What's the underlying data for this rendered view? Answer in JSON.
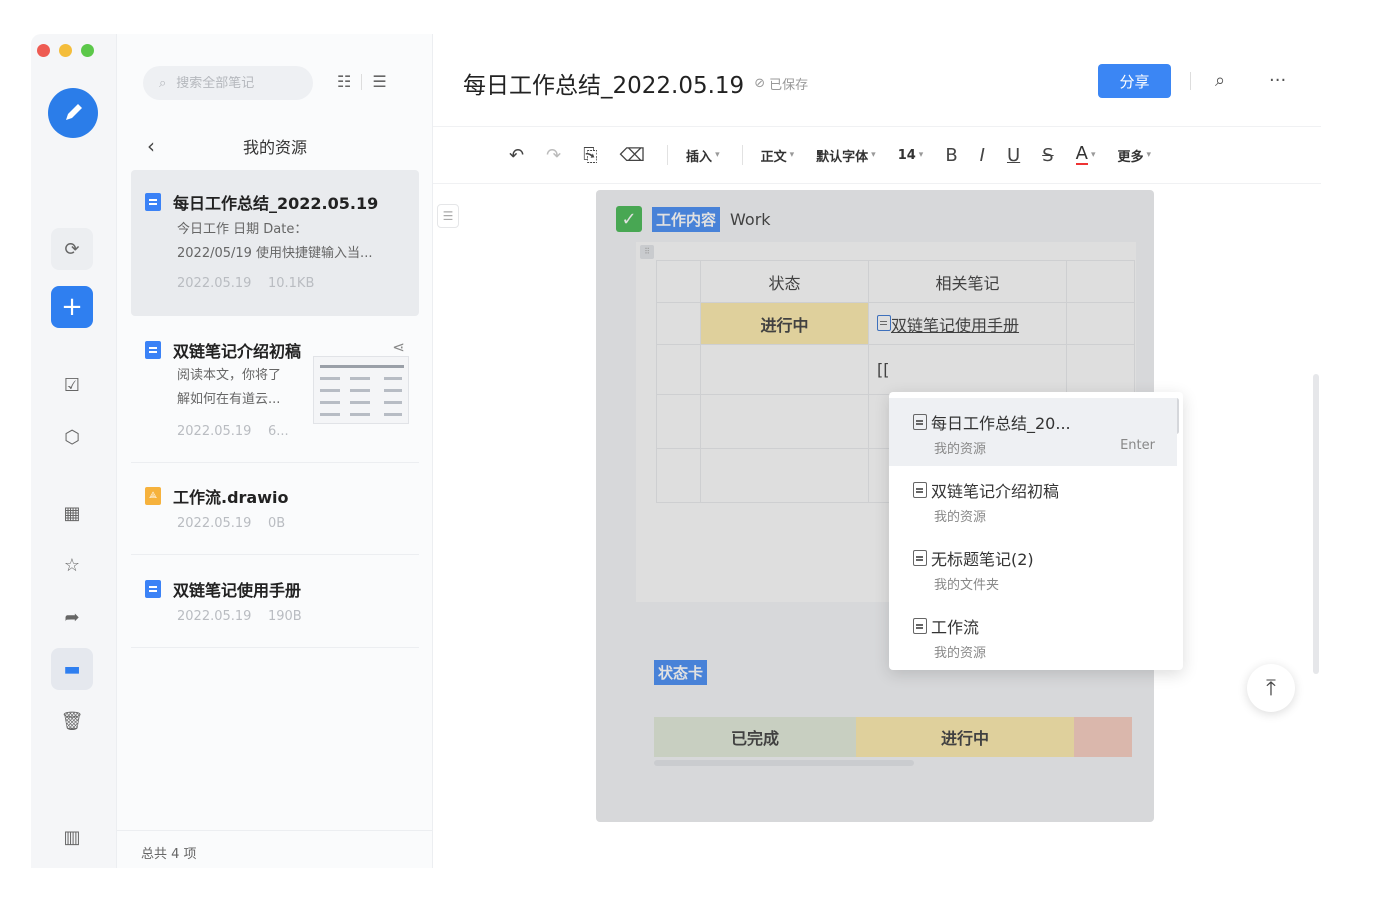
{
  "window": {
    "traffic_colors": [
      "#ee5b52",
      "#f4bd3b",
      "#5cc84a"
    ]
  },
  "rail": {
    "icons": [
      "sync-icon",
      "add-icon",
      "task-icon",
      "tag-icon",
      "apps-icon",
      "star-icon",
      "share-icon",
      "folder-icon",
      "trash-icon",
      "layout-icon"
    ],
    "add_label": "+"
  },
  "list": {
    "search_placeholder": "搜索全部笔记",
    "header_title": "我的资源",
    "footer": "总共 4 项",
    "notes": [
      {
        "title": "每日工作总结_2022.05.19",
        "summary_line1": "今日工作 日期 Date：",
        "summary_line2": "2022/05/19 使用快捷键输入当...",
        "date": "2022.05.19",
        "size": "10.1KB"
      },
      {
        "title": "双链笔记介绍初稿",
        "summary_line1": "阅读本文，你将了",
        "summary_line2": "解如何在有道云...",
        "date": "2022.05.19",
        "size": "6..."
      },
      {
        "title": "工作流.drawio",
        "date": "2022.05.19",
        "size": "0B"
      },
      {
        "title": "双链笔记使用手册",
        "date": "2022.05.19",
        "size": "190B"
      }
    ]
  },
  "editor": {
    "title": "每日工作总结_2022.05.19",
    "saved_label": "已保存",
    "share_label": "分享",
    "toolbar": {
      "insert": "插入",
      "paragraph": "正文",
      "font": "默认字体",
      "size": "14",
      "bold": "B",
      "italic": "I",
      "underline": "U",
      "strike": "S",
      "color": "A",
      "more": "更多"
    },
    "section": {
      "tag": "工作内容",
      "word": "Work"
    },
    "table": {
      "headers": [
        "状态",
        "相关笔记"
      ],
      "row1": [
        "进行中",
        "双链笔记使用手册"
      ],
      "typing": "[["
    },
    "status_card": {
      "tag": "状态卡",
      "done": "已完成",
      "in_progress": "进行中"
    },
    "popup": {
      "items": [
        {
          "title": "每日工作总结_20...",
          "sub": "我的资源",
          "key": "Enter"
        },
        {
          "title": "双链笔记介绍初稿",
          "sub": "我的资源"
        },
        {
          "title": "无标题笔记(2)",
          "sub": "我的文件夹"
        },
        {
          "title": "工作流",
          "sub": "我的资源"
        }
      ]
    }
  },
  "colors": {
    "accent": "#3b86f4",
    "tag_green": "#3cb54a",
    "cell_yellow": "#fdeaa7",
    "cell_green": "#dfe8d6",
    "cell_red": "#f7c9bb"
  }
}
